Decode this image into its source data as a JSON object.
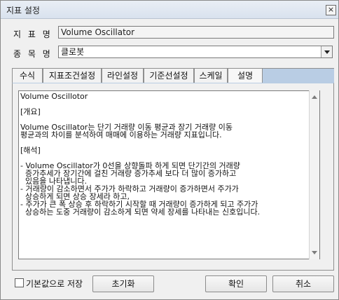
{
  "window": {
    "title": "지표 설정",
    "close_label": "×"
  },
  "form": {
    "indicator_label": "지 표 명",
    "indicator_value": "Volume Oscillator",
    "item_label": "종 목 명",
    "item_value": "클로봇"
  },
  "tabs": [
    {
      "label": "수식"
    },
    {
      "label": "지표조건설정"
    },
    {
      "label": "라인설정"
    },
    {
      "label": "기준선설정"
    },
    {
      "label": "스케일"
    },
    {
      "label": "설명"
    }
  ],
  "active_tab": "설명",
  "description": {
    "text": "Volume Oscillotor\n\n[개요]\n\nVolume Oscillator는 단기 거래량 이동 평균과 장기 거래량 이동\n평균과의 차이를 분석하여 매매에 이용하는 거래량 지표입니다.\n\n[해석]\n\n- Volume Oscillator가 0선을 상향돌파 하게 되면 단기간의 거래량\n  증가추세가 장기간에 걸친 거래량 증가추세 보다 더 많이 증가하고\n  있음을 나타냅니다.\n- 거래량이 감소하면서 주가가 하락하고 거래량이 증가하면서 주가가\n  상승하게 되면 상승 장세라 하고,\n- 주가가 큰 폭 상승 후 하락하기 시작할 때 거래량이 증가하게 되고 주가가\n  상승하는 도중 거래량이 감소하게 되면 약세 장세를 나타내는 신호입니다."
  },
  "footer": {
    "save_default_label": "기본값으로 저장",
    "reset_label": "초기화",
    "ok_label": "확인",
    "cancel_label": "취소"
  }
}
